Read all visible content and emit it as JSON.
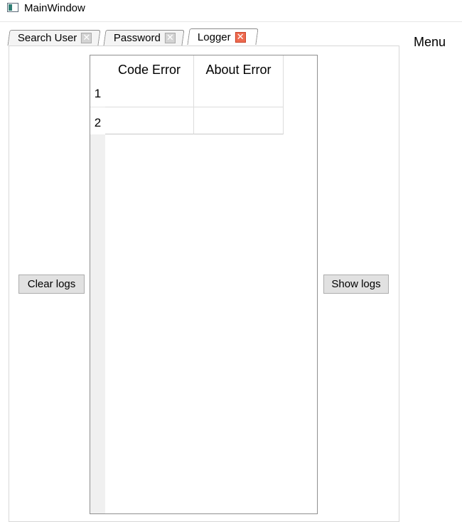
{
  "window": {
    "title": "MainWindow"
  },
  "tabs": [
    {
      "label": "Search User",
      "close_icon": "close-icon"
    },
    {
      "label": "Password",
      "close_icon": "close-icon"
    },
    {
      "label": "Logger",
      "close_icon": "close-icon",
      "active": true
    }
  ],
  "menu": {
    "label": "Menu"
  },
  "logger": {
    "clear_button": "Clear logs",
    "show_button": "Show logs",
    "table": {
      "columns": [
        "Code Error",
        "About Error"
      ],
      "row_headers": [
        "1",
        "2"
      ],
      "rows": [
        [
          "",
          ""
        ],
        [
          "",
          ""
        ]
      ]
    }
  },
  "colors": {
    "active_close": "#ee6a4f",
    "inactive_close": "#d3d3d3",
    "button_bg": "#e1e1e1"
  }
}
